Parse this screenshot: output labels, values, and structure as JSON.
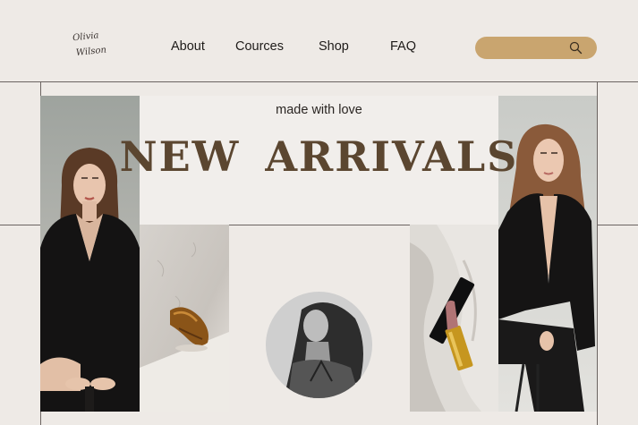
{
  "logo": {
    "line1": "Olivia",
    "line2": "Wilson"
  },
  "nav": {
    "items": [
      {
        "label": "About"
      },
      {
        "label": "Cources"
      },
      {
        "label": "Shop"
      },
      {
        "label": "FAQ"
      }
    ]
  },
  "search": {
    "value": "",
    "icon": "search-icon"
  },
  "hero": {
    "tagline": "made with love",
    "headline": "NEW ARRIVALS"
  },
  "colors": {
    "background": "#eeeae6",
    "accent": "#c9a56f",
    "headline": "#5b4630"
  }
}
